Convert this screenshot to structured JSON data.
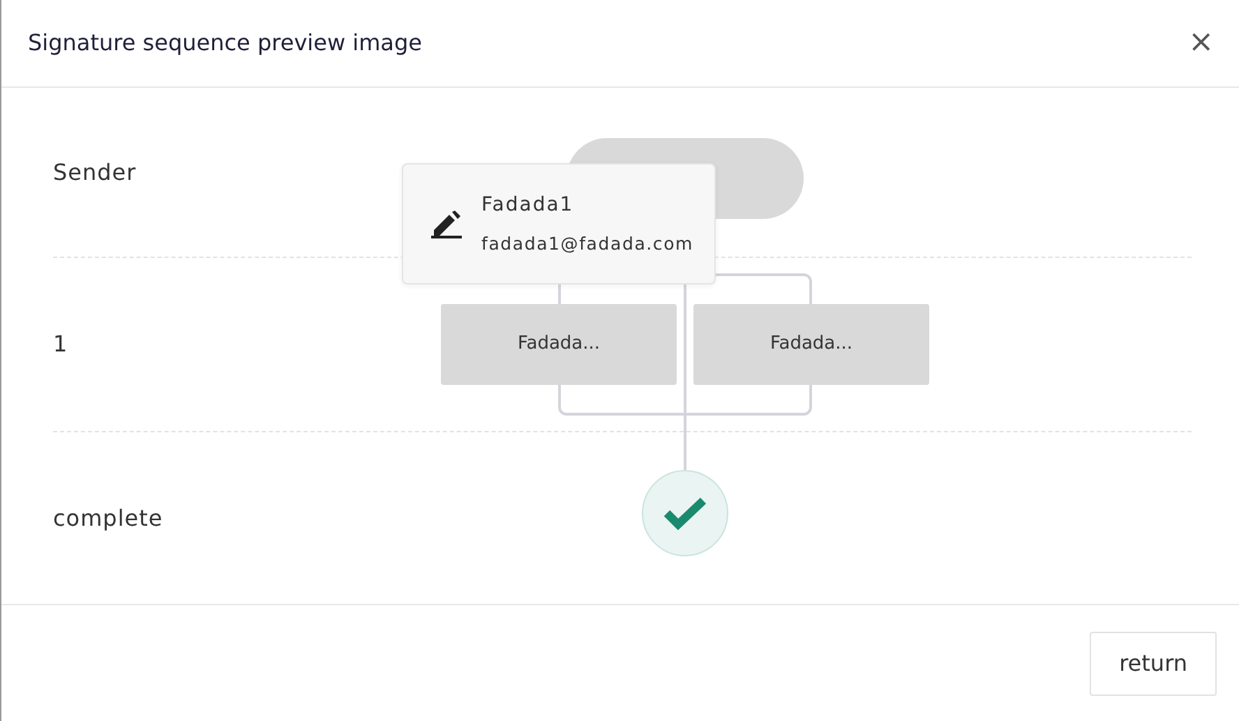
{
  "dialog": {
    "title": "Signature sequence preview image",
    "close": "×"
  },
  "rows": [
    {
      "label": "Sender"
    },
    {
      "label": "1"
    },
    {
      "label": "complete"
    }
  ],
  "flow": {
    "start": {
      "kind": "start"
    },
    "nodes": [
      {
        "label": "Fadada..."
      },
      {
        "label": "Fadada..."
      }
    ],
    "popover": {
      "name": "Fadada1",
      "email": "fadada1@fadada.com"
    },
    "end": {
      "kind": "complete"
    }
  },
  "footer": {
    "buttons": [
      "return"
    ]
  }
}
